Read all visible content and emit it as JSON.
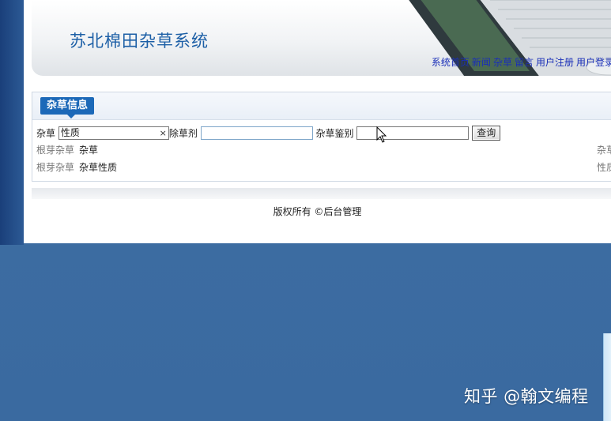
{
  "site": {
    "title": "苏北棉田杂草系统"
  },
  "nav": {
    "items": [
      "系统首页",
      "新闻",
      "杂草",
      "留言",
      "用户注册",
      "用户登录"
    ]
  },
  "panel": {
    "tab_label": "杂草信息"
  },
  "search": {
    "weed_label": "杂草",
    "weed_value": "性质",
    "herbicide_label": "除草剂",
    "herbicide_value": "",
    "identify_label": "杂草鉴别",
    "identify_value": "",
    "clear_symbol": "×",
    "button_label": "查询"
  },
  "rows": [
    {
      "key": "根芽杂草",
      "value": "杂草",
      "right": "杂草"
    },
    {
      "key": "根芽杂草",
      "value": "杂草性质",
      "right": "性质"
    }
  ],
  "footer": {
    "text": "版权所有 ©后台管理"
  },
  "watermark": {
    "text": "知乎 @翰文编程"
  },
  "colors": {
    "background": "#3f6ea3",
    "accent": "#1c69b8",
    "title": "#1c5fa6",
    "nav_link": "#1a2fb8"
  }
}
